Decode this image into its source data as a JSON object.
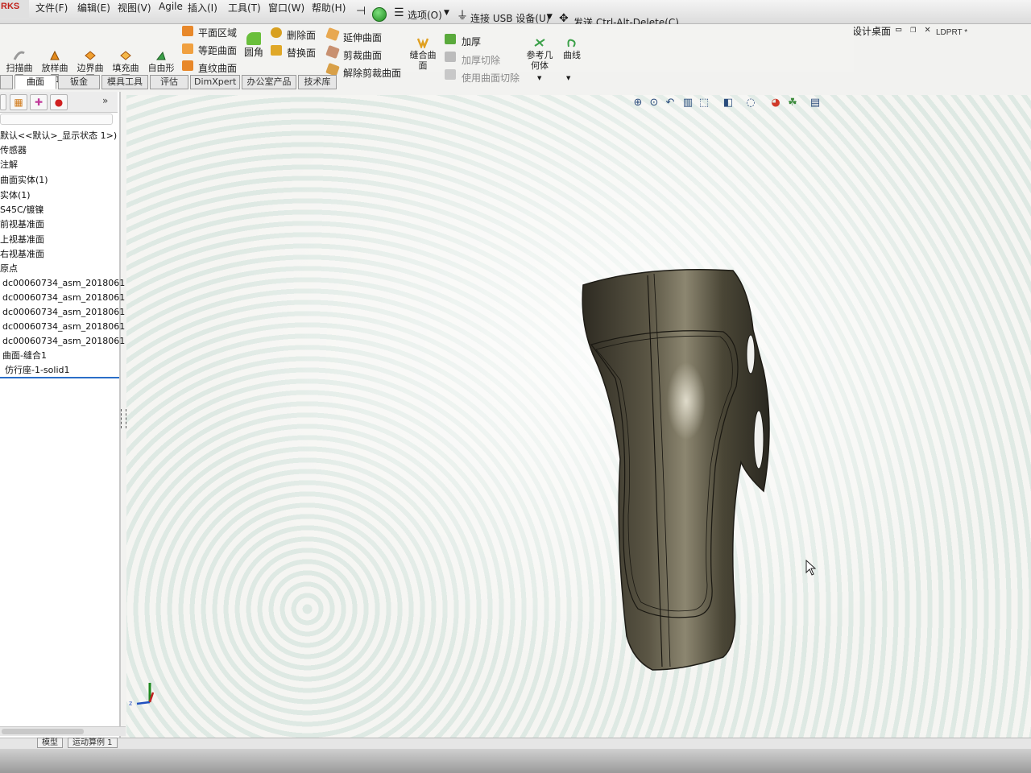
{
  "brand": "RKS",
  "menu": [
    "文件(F)",
    "编辑(E)",
    "视图(V)",
    "Agile",
    "插入(I)",
    "工具(T)",
    "窗口(W)",
    "帮助(H)"
  ],
  "quick_access": {
    "options": "选项(O)",
    "connect_usb": "连接 USB 设备(U)",
    "send_cad": "发送 Ctrl-Alt-Delete(C)"
  },
  "title_bar": {
    "design_desk": "设计桌面",
    "document": "LDPRT *"
  },
  "ribbon": {
    "big": [
      {
        "label1": "扫描曲",
        "label2": "面",
        "icon": "sweep-surface-icon"
      },
      {
        "label1": "放样曲",
        "label2": "面",
        "icon": "loft-surface-icon"
      },
      {
        "label1": "边界曲",
        "label2": "面",
        "icon": "boundary-surface-icon"
      },
      {
        "label1": "填充曲",
        "label2": "面",
        "icon": "fill-surface-icon"
      },
      {
        "label1": "自由形",
        "label2": "",
        "icon": "freeform-icon"
      }
    ],
    "col1": [
      "平面区域",
      "等距曲面",
      "直纹曲面"
    ],
    "fillet": "圆角",
    "col2": [
      "删除面",
      "替换面"
    ],
    "col3": [
      "延伸曲面",
      "剪裁曲面",
      "解除剪裁曲面"
    ],
    "knit": {
      "label1": "缝合曲",
      "label2": "面"
    },
    "col4": [
      "加厚",
      "加厚切除",
      "使用曲面切除"
    ],
    "ref_geometry": {
      "label1": "参考几",
      "label2": "何体"
    },
    "curves": "曲线"
  },
  "tabs": [
    "",
    "曲面",
    "钣金",
    "模具工具",
    "评估",
    "DimXpert",
    "办公室产品",
    "技术库"
  ],
  "feature_tree": [
    "默认<<默认>_显示状态 1>)",
    "传感器",
    "注解",
    "曲面实体(1)",
    "实体(1)",
    "S45C/镀镍",
    "前视基准面",
    "上视基准面",
    "右视基准面",
    "原点",
    "dc00060734_asm_2018061",
    "dc00060734_asm_2018061",
    "dc00060734_asm_2018061",
    "dc00060734_asm_2018061",
    "dc00060734_asm_2018061",
    "曲面-缝合1",
    "仿行座-1-solid1"
  ],
  "bottom_tabs": [
    "模型",
    "运动算例 1"
  ],
  "triad": {
    "z": "z"
  },
  "colors": {
    "brand_red": "#c0201a",
    "model_body": "#4a4636",
    "selection_blue": "#2a6ec8"
  }
}
